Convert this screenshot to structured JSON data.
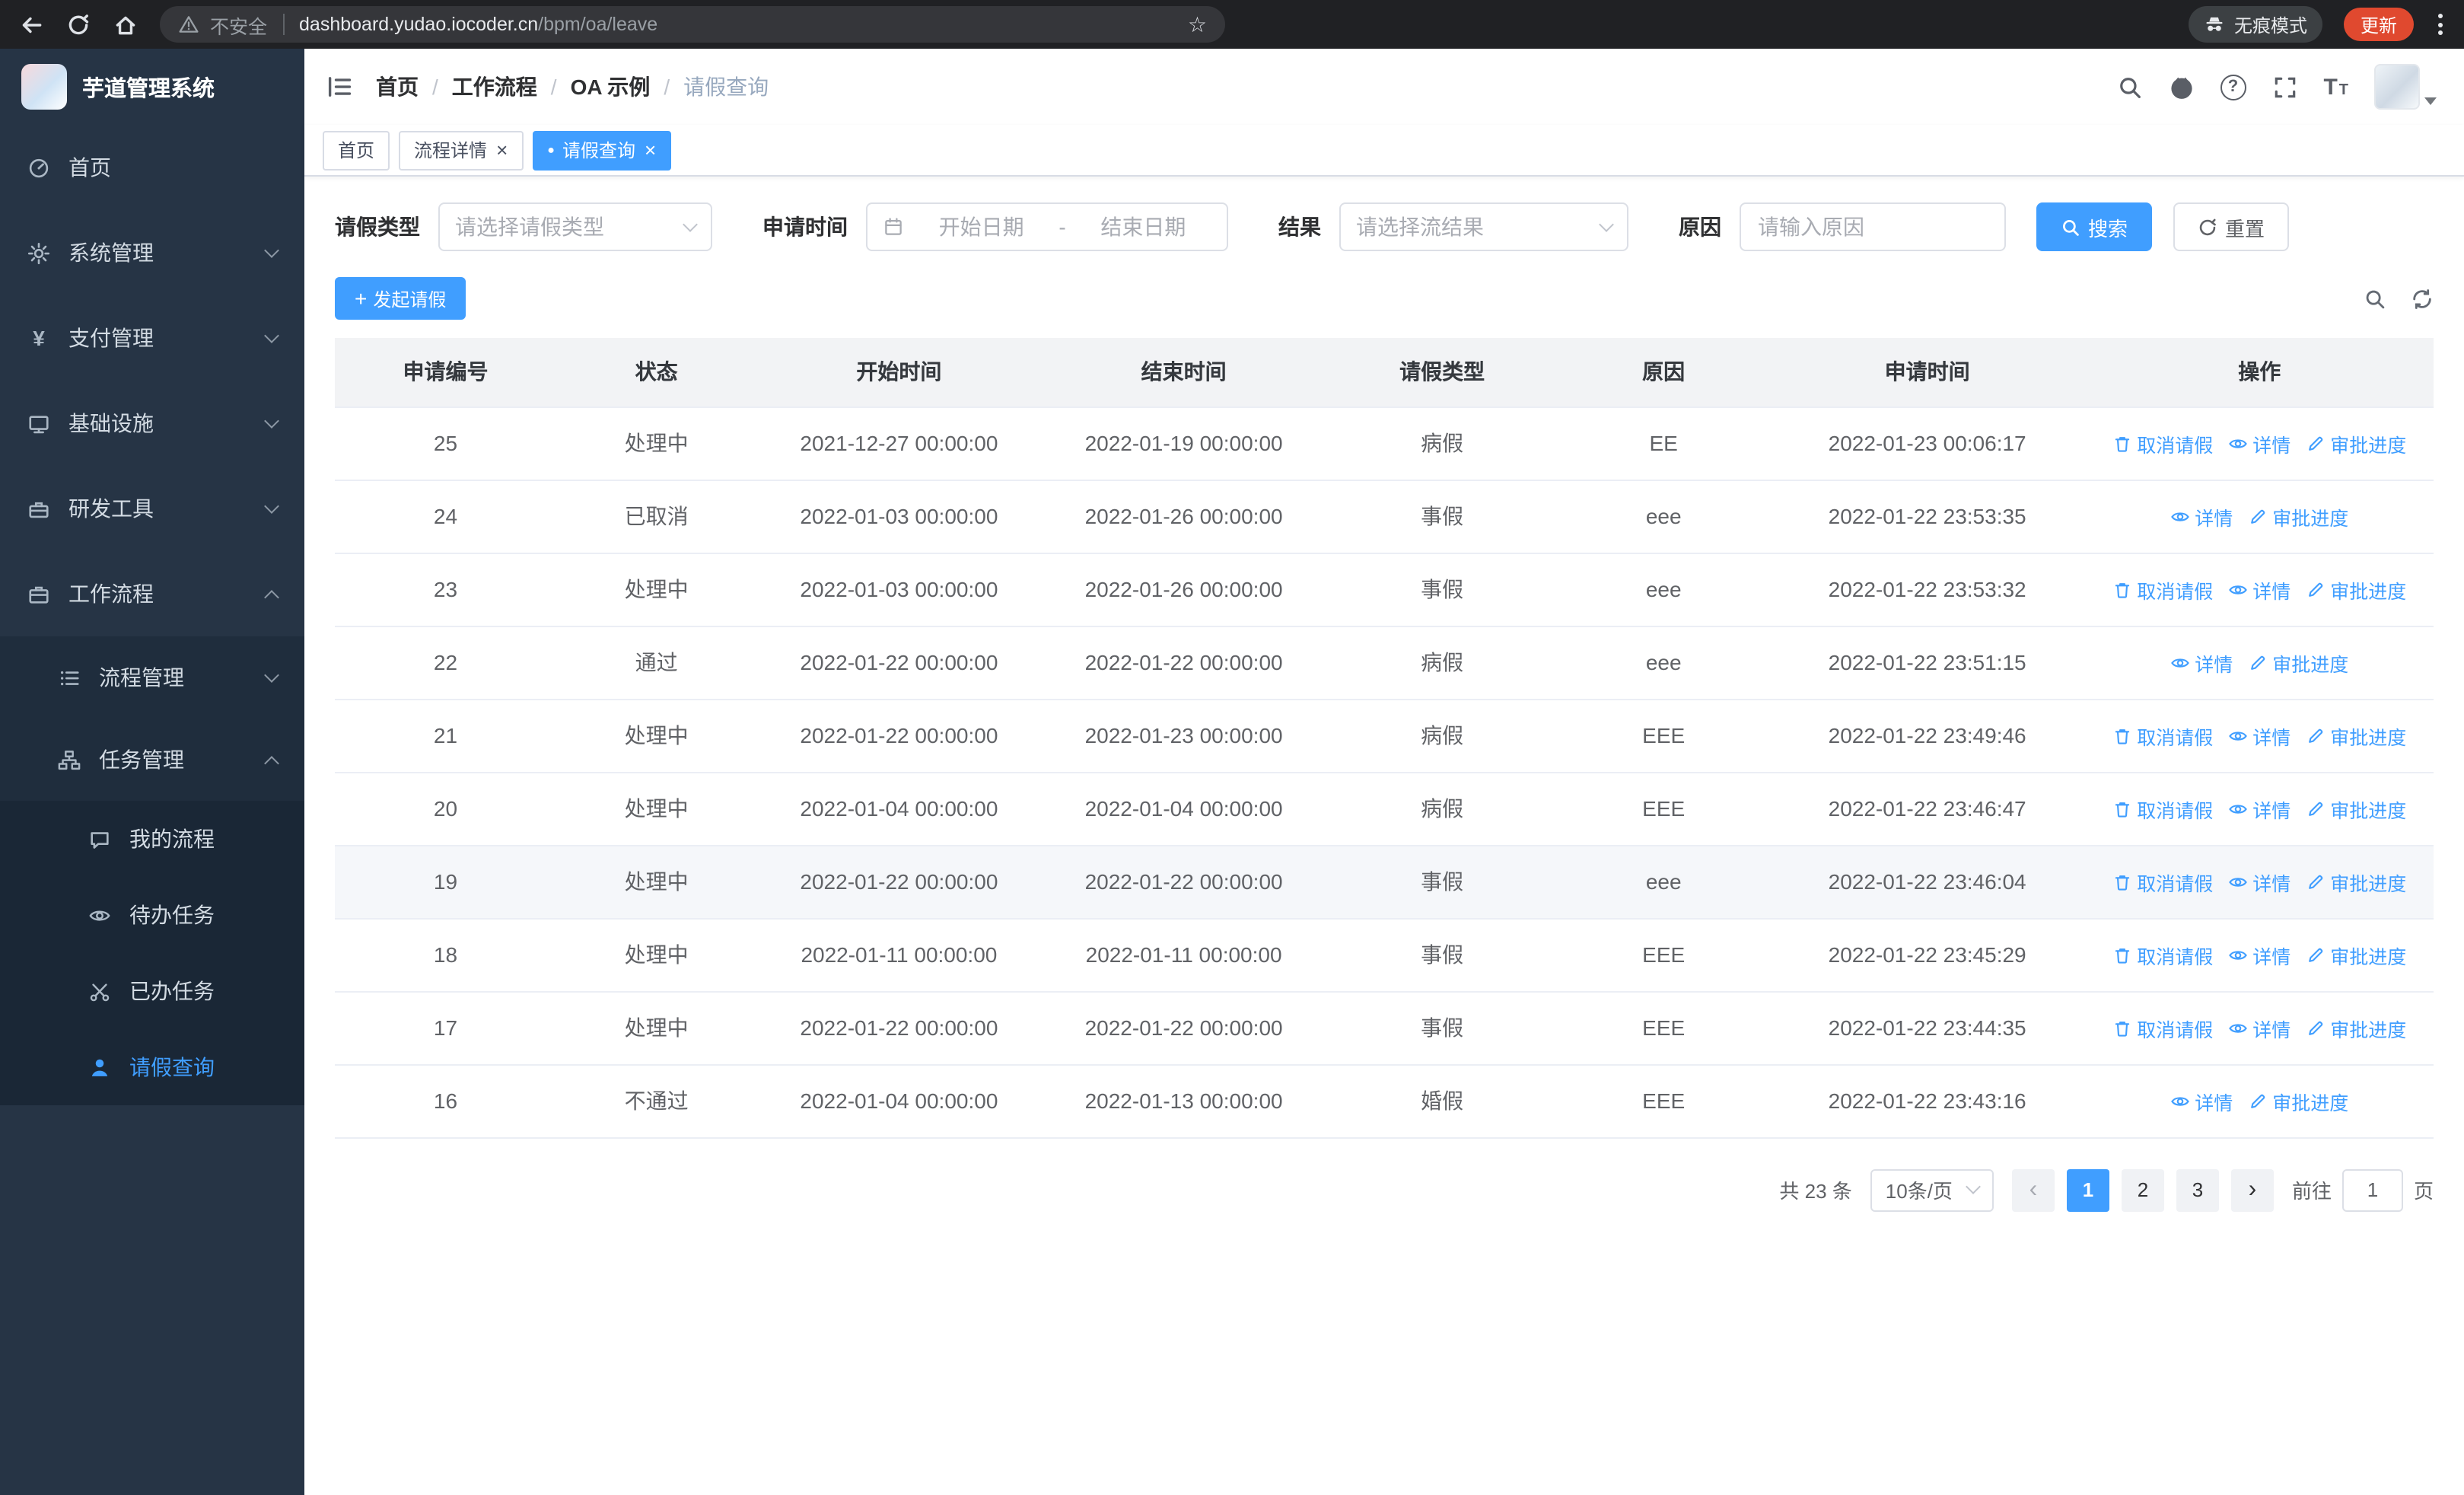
{
  "colors": {
    "primary": "#409eff",
    "chrome_bg": "#202124",
    "omnibox_bg": "#35363a",
    "badge_bg": "#3c4043",
    "update_pill": "#e0492f",
    "sidebar_bg": "#263445",
    "submenu_bg": "#1f2d3d",
    "leaf_bg": "#1a2736"
  },
  "glyphs": {
    "yen": "¥",
    "plus": "+",
    "close": "×",
    "dot": "●",
    "star": "☆",
    "question": "?",
    "font_large": "T",
    "font_small": "T",
    "chevron_left": "‹",
    "chevron_right": "›"
  },
  "browser": {
    "security_warning": "不安全",
    "url_host": "dashboard.yudao.iocoder.cn",
    "url_path": "/bpm/oa/leave",
    "incognito_label": "无痕模式",
    "update_button": "更新"
  },
  "sidebar": {
    "logo_title": "芋道管理系统",
    "items": [
      {
        "label": "首页"
      },
      {
        "label": "系统管理"
      },
      {
        "label": "支付管理"
      },
      {
        "label": "基础设施"
      },
      {
        "label": "研发工具"
      },
      {
        "label": "工作流程"
      }
    ],
    "workflow_children": [
      {
        "label": "流程管理"
      },
      {
        "label": "任务管理"
      }
    ],
    "task_children": [
      {
        "label": "我的流程"
      },
      {
        "label": "待办任务"
      },
      {
        "label": "已办任务"
      },
      {
        "label": "请假查询"
      }
    ]
  },
  "navbar": {
    "breadcrumb": [
      "首页",
      "工作流程",
      "OA 示例",
      "请假查询"
    ]
  },
  "tags": [
    {
      "label": "首页"
    },
    {
      "label": "流程详情"
    },
    {
      "label": "请假查询"
    }
  ],
  "filters": {
    "leave_type_label": "请假类型",
    "leave_type_placeholder": "请选择请假类型",
    "apply_time_label": "申请时间",
    "start_date_placeholder": "开始日期",
    "range_separator": "-",
    "end_date_placeholder": "结束日期",
    "result_label": "结果",
    "result_placeholder": "请选择流结果",
    "reason_label": "原因",
    "reason_placeholder": "请输入原因",
    "search_button": "搜索",
    "reset_button": "重置"
  },
  "toolbar": {
    "create_button": "发起请假"
  },
  "table": {
    "columns": [
      "申请编号",
      "状态",
      "开始时间",
      "结束时间",
      "请假类型",
      "原因",
      "申请时间",
      "操作"
    ],
    "action_labels": {
      "cancel": "取消请假",
      "detail": "详情",
      "progress": "审批进度"
    },
    "rows": [
      {
        "id": "25",
        "status": "处理中",
        "start": "2021-12-27 00:00:00",
        "end": "2022-01-19 00:00:00",
        "type": "病假",
        "reason": "EE",
        "applied": "2022-01-23 00:06:17",
        "actions": [
          "cancel",
          "detail",
          "progress"
        ]
      },
      {
        "id": "24",
        "status": "已取消",
        "start": "2022-01-03 00:00:00",
        "end": "2022-01-26 00:00:00",
        "type": "事假",
        "reason": "eee",
        "applied": "2022-01-22 23:53:35",
        "actions": [
          "detail",
          "progress"
        ]
      },
      {
        "id": "23",
        "status": "处理中",
        "start": "2022-01-03 00:00:00",
        "end": "2022-01-26 00:00:00",
        "type": "事假",
        "reason": "eee",
        "applied": "2022-01-22 23:53:32",
        "actions": [
          "cancel",
          "detail",
          "progress"
        ]
      },
      {
        "id": "22",
        "status": "通过",
        "start": "2022-01-22 00:00:00",
        "end": "2022-01-22 00:00:00",
        "type": "病假",
        "reason": "eee",
        "applied": "2022-01-22 23:51:15",
        "actions": [
          "detail",
          "progress"
        ]
      },
      {
        "id": "21",
        "status": "处理中",
        "start": "2022-01-22 00:00:00",
        "end": "2022-01-23 00:00:00",
        "type": "病假",
        "reason": "EEE",
        "applied": "2022-01-22 23:49:46",
        "actions": [
          "cancel",
          "detail",
          "progress"
        ]
      },
      {
        "id": "20",
        "status": "处理中",
        "start": "2022-01-04 00:00:00",
        "end": "2022-01-04 00:00:00",
        "type": "病假",
        "reason": "EEE",
        "applied": "2022-01-22 23:46:47",
        "actions": [
          "cancel",
          "detail",
          "progress"
        ]
      },
      {
        "id": "19",
        "status": "处理中",
        "start": "2022-01-22 00:00:00",
        "end": "2022-01-22 00:00:00",
        "type": "事假",
        "reason": "eee",
        "applied": "2022-01-22 23:46:04",
        "actions": [
          "cancel",
          "detail",
          "progress"
        ],
        "highlight": true
      },
      {
        "id": "18",
        "status": "处理中",
        "start": "2022-01-11 00:00:00",
        "end": "2022-01-11 00:00:00",
        "type": "事假",
        "reason": "EEE",
        "applied": "2022-01-22 23:45:29",
        "actions": [
          "cancel",
          "detail",
          "progress"
        ]
      },
      {
        "id": "17",
        "status": "处理中",
        "start": "2022-01-22 00:00:00",
        "end": "2022-01-22 00:00:00",
        "type": "事假",
        "reason": "EEE",
        "applied": "2022-01-22 23:44:35",
        "actions": [
          "cancel",
          "detail",
          "progress"
        ]
      },
      {
        "id": "16",
        "status": "不通过",
        "start": "2022-01-04 00:00:00",
        "end": "2022-01-13 00:00:00",
        "type": "婚假",
        "reason": "EEE",
        "applied": "2022-01-22 23:43:16",
        "actions": [
          "detail",
          "progress"
        ]
      }
    ]
  },
  "pagination": {
    "total_text": "共 23 条",
    "page_size": "10条/页",
    "pages": [
      "1",
      "2",
      "3"
    ],
    "active_page": "1",
    "goto_label": "前往",
    "goto_value": "1",
    "goto_suffix": "页"
  }
}
